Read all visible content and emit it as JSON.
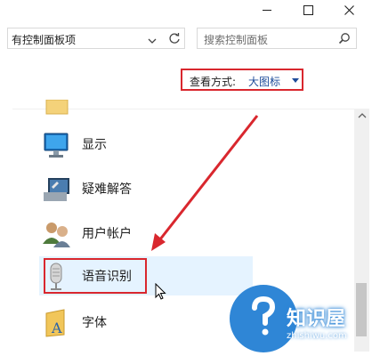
{
  "window": {
    "controls": [
      "minimize-icon",
      "maximize-icon",
      "close-icon"
    ]
  },
  "address_bar": {
    "path": "有控制面板项",
    "dropdown_icon": "chevron-down-icon",
    "refresh_icon": "refresh-icon"
  },
  "search": {
    "placeholder": "搜索控制面板",
    "icon": "search-icon"
  },
  "view_mode": {
    "label": "查看方式:",
    "value": "大图标",
    "highlight_color": "#d9272e"
  },
  "items": [
    {
      "label": "",
      "icon": "folder-icon"
    },
    {
      "label": "显示",
      "icon": "monitor-icon"
    },
    {
      "label": "疑难解答",
      "icon": "troubleshooting-icon"
    },
    {
      "label": "用户帐户",
      "icon": "user-accounts-icon"
    },
    {
      "label": "语音识别",
      "icon": "microphone-icon",
      "selected": true
    },
    {
      "label": "字体",
      "icon": "font-folder-icon"
    }
  ],
  "annotation": {
    "arrow_color": "#d9272e"
  },
  "watermark": {
    "text": "知识屋",
    "url": "zhishiwu.com"
  }
}
